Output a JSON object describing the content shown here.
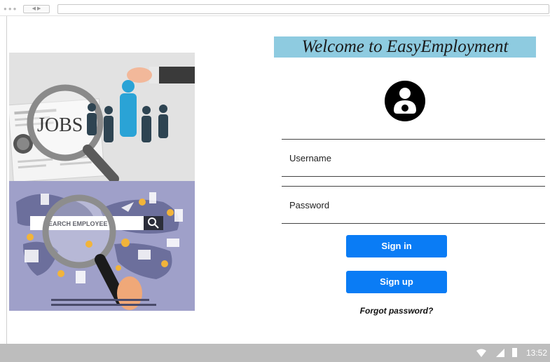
{
  "app": {
    "welcome": "Welcome to EasyEmployment"
  },
  "illustrations": {
    "top_sign": "JOBS",
    "search_label": "SEARCH EMPLOYEE"
  },
  "login": {
    "username_placeholder": "Username",
    "password_placeholder": "Password",
    "signin_label": "Sign in",
    "signup_label": "Sign up",
    "forgot_label": "Forgot password?"
  },
  "status_bar": {
    "time": "13:52"
  },
  "colors": {
    "accent": "#0a7cf5",
    "banner": "#8ecbe0",
    "status_bar": "#bdbdbd"
  },
  "icons": [
    "user-avatar-icon",
    "search-icon",
    "wifi-icon",
    "signal-icon",
    "battery-icon"
  ]
}
